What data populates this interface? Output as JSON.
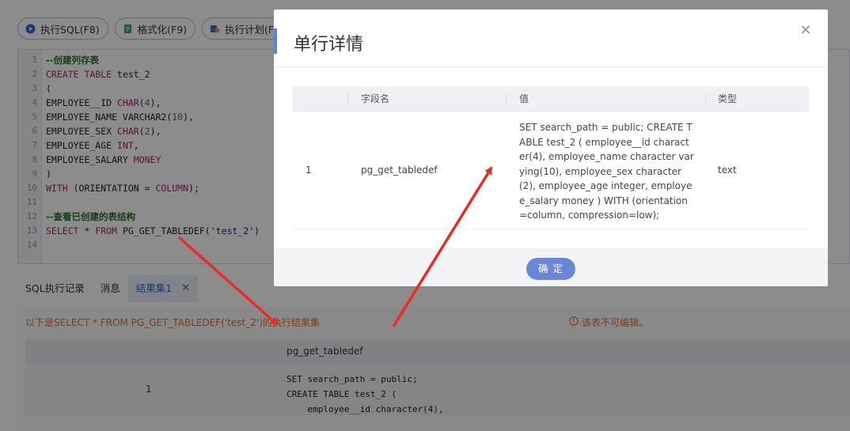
{
  "toolbar": {
    "execute_label": "执行SQL(F8)",
    "format_label": "格式化(F9)",
    "plan_label": "执行计划(F"
  },
  "editor": {
    "lines": [
      {
        "no": "1",
        "segments": [
          {
            "t": "--创建列存表",
            "c": "cm"
          }
        ]
      },
      {
        "no": "2",
        "segments": [
          {
            "t": "CREATE TABLE",
            "c": "kw"
          },
          {
            "t": " test_2",
            "c": ""
          }
        ]
      },
      {
        "no": "3",
        "segments": [
          {
            "t": "(",
            "c": ""
          }
        ]
      },
      {
        "no": "4",
        "segments": [
          {
            "t": "EMPLOYEE__ID ",
            "c": ""
          },
          {
            "t": "CHAR",
            "c": "kw"
          },
          {
            "t": "(",
            "c": ""
          },
          {
            "t": "4",
            "c": "num"
          },
          {
            "t": "),",
            "c": ""
          }
        ]
      },
      {
        "no": "5",
        "segments": [
          {
            "t": "EMPLOYEE_NAME VARCHAR2(",
            "c": ""
          },
          {
            "t": "10",
            "c": "num"
          },
          {
            "t": "),",
            "c": ""
          }
        ]
      },
      {
        "no": "6",
        "segments": [
          {
            "t": "EMPLOYEE_SEX ",
            "c": ""
          },
          {
            "t": "CHAR",
            "c": "kw"
          },
          {
            "t": "(",
            "c": ""
          },
          {
            "t": "2",
            "c": "num"
          },
          {
            "t": "),",
            "c": ""
          }
        ]
      },
      {
        "no": "7",
        "segments": [
          {
            "t": "EMPLOYEE_AGE ",
            "c": ""
          },
          {
            "t": "INT",
            "c": "kw"
          },
          {
            "t": ",",
            "c": ""
          }
        ]
      },
      {
        "no": "8",
        "segments": [
          {
            "t": "EMPLOYEE_SALARY ",
            "c": ""
          },
          {
            "t": "MONEY",
            "c": "kw"
          }
        ]
      },
      {
        "no": "9",
        "segments": [
          {
            "t": ")",
            "c": ""
          }
        ]
      },
      {
        "no": "10",
        "segments": [
          {
            "t": "WITH",
            "c": "kw"
          },
          {
            "t": " (ORIENTATION = ",
            "c": ""
          },
          {
            "t": "COLUMN",
            "c": "kw"
          },
          {
            "t": ");",
            "c": ""
          }
        ]
      },
      {
        "no": "11",
        "segments": []
      },
      {
        "no": "12",
        "segments": [
          {
            "t": "--查看已创建的表结构",
            "c": "cm"
          }
        ]
      },
      {
        "no": "13",
        "segments": [
          {
            "t": "SELECT",
            "c": "kw"
          },
          {
            "t": " * ",
            "c": ""
          },
          {
            "t": "FROM",
            "c": "kw"
          },
          {
            "t": " PG_GET_TABLEDEF(",
            "c": ""
          },
          {
            "t": "'test_2'",
            "c": "str"
          },
          {
            "t": ")",
            "c": ""
          }
        ]
      },
      {
        "no": "14",
        "segments": []
      }
    ]
  },
  "result_tabs": {
    "history": "SQL执行记录",
    "messages": "消息",
    "resultset": "结果集1",
    "close": "✕"
  },
  "results": {
    "message": "以下是SELECT * FROM PG_GET_TABLEDEF('test_2')的执行结果集",
    "readonly_notice": "该表不可编辑。",
    "column_header": "pg_get_tabledef",
    "row_number": "1",
    "cell_preview": "SET search_path = public;\nCREATE TABLE test_2 (\n    employee__id character(4),"
  },
  "modal": {
    "title": "单行详情",
    "close": "×",
    "headers": {
      "field_name": "字段名",
      "value": "值",
      "type": "类型"
    },
    "row": {
      "index": "1",
      "field_name": "pg_get_tabledef",
      "value": "SET search_path = public; CREATE TABLE test_2 ( employee__id character(4), employee_name character varying(10), employee_sex character(2), employee_age integer, employee_salary money ) WITH (orientation=column, compression=low);",
      "type": "text"
    },
    "ok_label": "确 定"
  },
  "colors": {
    "accent": "#5a82dc",
    "ok_button": "#6a86d9",
    "warning_text": "#e0712a",
    "annotation_arrow": "#ee2a24"
  }
}
